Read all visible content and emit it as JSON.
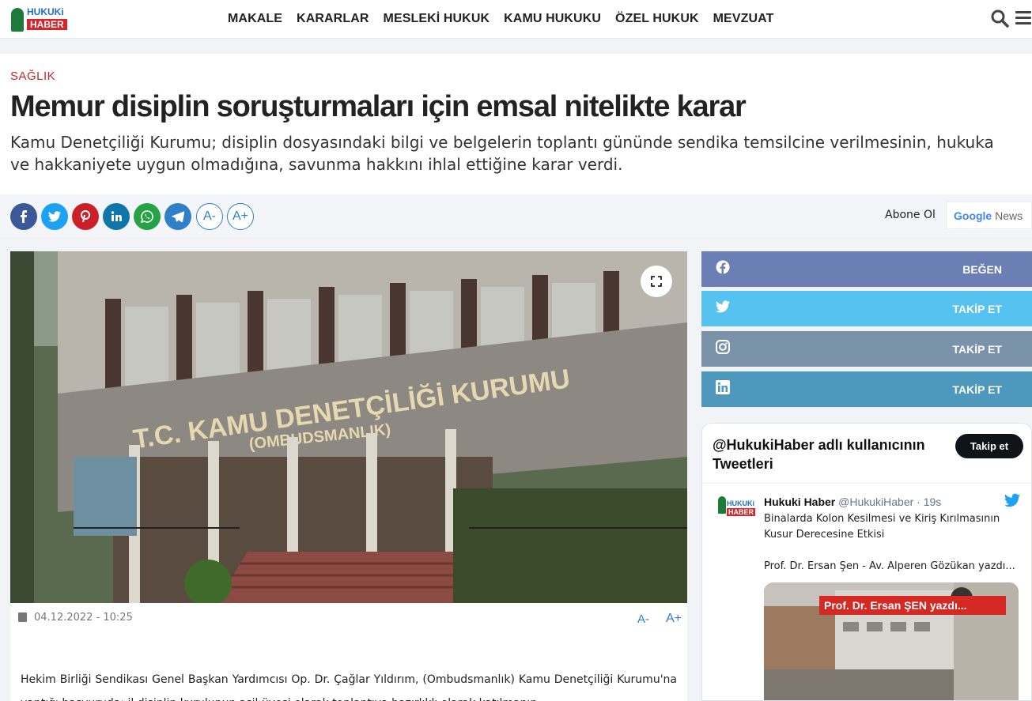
{
  "logo": {
    "line1": "HUKUKi",
    "line2": "HABER"
  },
  "nav": [
    "MAKALE",
    "KARARLAR",
    "MESLEKİ HUKUK",
    "KAMU HUKUKU",
    "ÖZEL HUKUK",
    "MEVZUAT"
  ],
  "article": {
    "category": "SAĞLIK",
    "title": "Memur disiplin soruşturmaları için emsal nitelikte karar",
    "summary": "Kamu Denetçiliği Kurumu; disiplin dosyasındaki bilgi ve belgelerin toplantı gününde sendika temsilcine verilmesinin, hukuka ve hakkaniyete uygun olmadığına, savunma hakkını ihlal ettiğine karar verdi.",
    "date": "04.12.2022 - 10:25",
    "font_minus": "A-",
    "font_plus": "A+",
    "body": "Hekim Birliği Sendikası Genel Başkan Yardımcısı Op. Dr. Çağlar Yıldırım, (Ombudsmanlık) Kamu Denetçiliği Kurumu'na yaptığı başvuruda; il disiplin kurulunun asil üyesi olarak toplantıya hazırlıklı olarak katılmanın"
  },
  "share": {
    "icons": [
      "facebook-icon",
      "twitter-icon",
      "pinterest-icon",
      "linkedin-icon",
      "whatsapp-icon",
      "telegram-icon"
    ],
    "colors": [
      "#3b5998",
      "#1da1f2",
      "#cb2027",
      "#0e76a8",
      "#25a244",
      "#2f80c8"
    ],
    "font_minus": "A-",
    "font_plus": "A+",
    "subscribe": "Abone Ol",
    "gnews_google": "Google",
    "gnews_news": "News"
  },
  "photo": {
    "sign_main": "T.C. KAMU DENETÇİLİĞİ KURUMU",
    "sign_sub": "(OMBUDSMANLIK)"
  },
  "social": [
    {
      "network": "facebook",
      "label": "BEĞEN",
      "color": "#6b7fb5"
    },
    {
      "network": "twitter",
      "label": "TAKİP ET",
      "color": "#55c2ef"
    },
    {
      "network": "instagram",
      "label": "TAKİP ET",
      "color": "#7b93a9"
    },
    {
      "network": "linkedin",
      "label": "TAKİP ET",
      "color": "#4e98bd"
    }
  ],
  "twitter": {
    "title": "@HukukiHaber adlı kullanıcının Tweetleri",
    "follow": "Takip et",
    "name": "Hukuki Haber",
    "handle": "@HukukiHaber · 19s",
    "text": "Binalarda Kolon Kesilmesi ve Kiriş Kırılmasının Kusur Derecesine Etkisi",
    "text2": "Prof. Dr. Ersan Şen - Av. Alperen Gözükan yazdı...",
    "image_banner": "Prof. Dr. Ersan ŞEN    yazdı..."
  }
}
